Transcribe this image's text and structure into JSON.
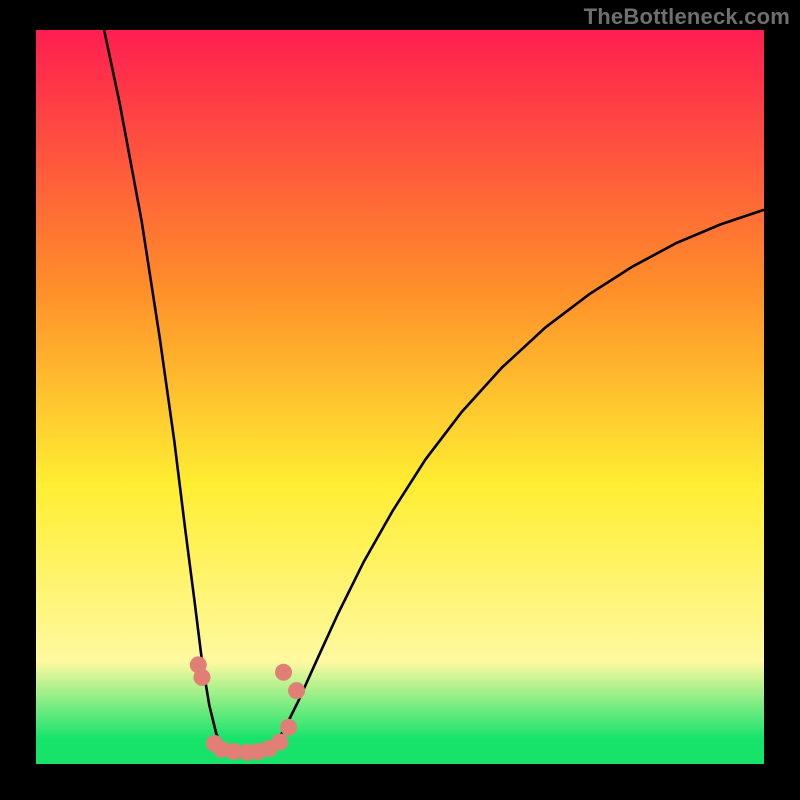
{
  "watermark": "TheBottleneck.com",
  "colors": {
    "black": "#000000",
    "watermark_gray": "#6f6f6f",
    "curve_black": "#000000",
    "marker_salmon": "#e17f77",
    "grad_top": "#ff1e50",
    "grad_mid_orange": "#ff8e2a",
    "grad_yellow": "#ffee32",
    "grad_pale_yellow": "#fff9a0",
    "grad_green": "#17e36b"
  },
  "chart_data": {
    "type": "line",
    "title": "",
    "xlabel": "",
    "ylabel": "",
    "x": [
      0.0,
      0.02,
      0.04,
      0.06,
      0.08,
      0.1,
      0.12,
      0.14,
      0.16,
      0.18,
      0.2,
      0.22,
      0.24,
      0.26,
      0.28,
      0.3,
      0.32,
      0.34,
      0.36,
      0.38,
      0.4,
      0.42,
      0.44,
      0.46,
      0.48,
      0.5,
      0.52,
      0.54,
      0.56,
      0.58,
      0.6,
      0.62,
      0.64,
      0.66,
      0.68,
      0.7,
      0.72,
      0.74,
      0.76,
      0.78,
      0.8,
      0.82,
      0.84,
      0.86,
      0.88,
      0.9,
      0.92,
      0.94,
      0.96,
      0.98,
      1.0
    ],
    "series": [
      {
        "name": "left-branch",
        "values": [
          1.0,
          0.94,
          0.88,
          0.82,
          0.76,
          0.7,
          0.64,
          0.58,
          0.52,
          0.46,
          0.4,
          0.34,
          0.29,
          0.24,
          0.19,
          0.15,
          0.11,
          0.08,
          0.05,
          0.035,
          0.025,
          0.018,
          0.012,
          0.008,
          0.005,
          0.003,
          0.002,
          0.0015,
          0.001,
          0.0008,
          0.0006,
          0.0006,
          0.0008,
          0.001,
          0.0015,
          0.002,
          0.003,
          0.005,
          0.008,
          0.012,
          0.018,
          0.025,
          0.035,
          0.05,
          0.08,
          0.11,
          0.15,
          0.19,
          0.24,
          0.29,
          0.34
        ]
      },
      {
        "name": "right-branch",
        "values": [
          null,
          null,
          null,
          null,
          null,
          null,
          null,
          null,
          null,
          null,
          null,
          null,
          null,
          null,
          null,
          0.001,
          0.003,
          0.007,
          0.015,
          0.03,
          0.05,
          0.08,
          0.12,
          0.16,
          0.2,
          0.24,
          0.28,
          0.32,
          0.36,
          0.4,
          0.44,
          0.48,
          0.51,
          0.54,
          0.57,
          0.6,
          0.63,
          0.66,
          0.68,
          0.7,
          0.72,
          0.74,
          0.76,
          0.77,
          0.78,
          0.79,
          0.8,
          0.805,
          0.81,
          0.815,
          0.82
        ]
      }
    ],
    "markers": {
      "name": "salmon-dots",
      "points": [
        {
          "x": 0.223,
          "y": 0.135
        },
        {
          "x": 0.228,
          "y": 0.118
        },
        {
          "x": 0.245,
          "y": 0.028
        },
        {
          "x": 0.255,
          "y": 0.02
        },
        {
          "x": 0.272,
          "y": 0.017
        },
        {
          "x": 0.29,
          "y": 0.016
        },
        {
          "x": 0.305,
          "y": 0.017
        },
        {
          "x": 0.32,
          "y": 0.021
        },
        {
          "x": 0.335,
          "y": 0.03
        },
        {
          "x": 0.347,
          "y": 0.05
        },
        {
          "x": 0.34,
          "y": 0.125
        },
        {
          "x": 0.358,
          "y": 0.1
        }
      ]
    },
    "xlim": [
      0,
      1
    ],
    "ylim": [
      0,
      1
    ],
    "grid": false,
    "gradient_stops": [
      {
        "pos": 0.0,
        "color": "#ff1e50"
      },
      {
        "pos": 0.35,
        "color": "#ff8e2a"
      },
      {
        "pos": 0.62,
        "color": "#ffee32"
      },
      {
        "pos": 0.86,
        "color": "#fff9a0"
      },
      {
        "pos": 0.965,
        "color": "#17e36b"
      },
      {
        "pos": 1.0,
        "color": "#17e36b"
      }
    ]
  }
}
